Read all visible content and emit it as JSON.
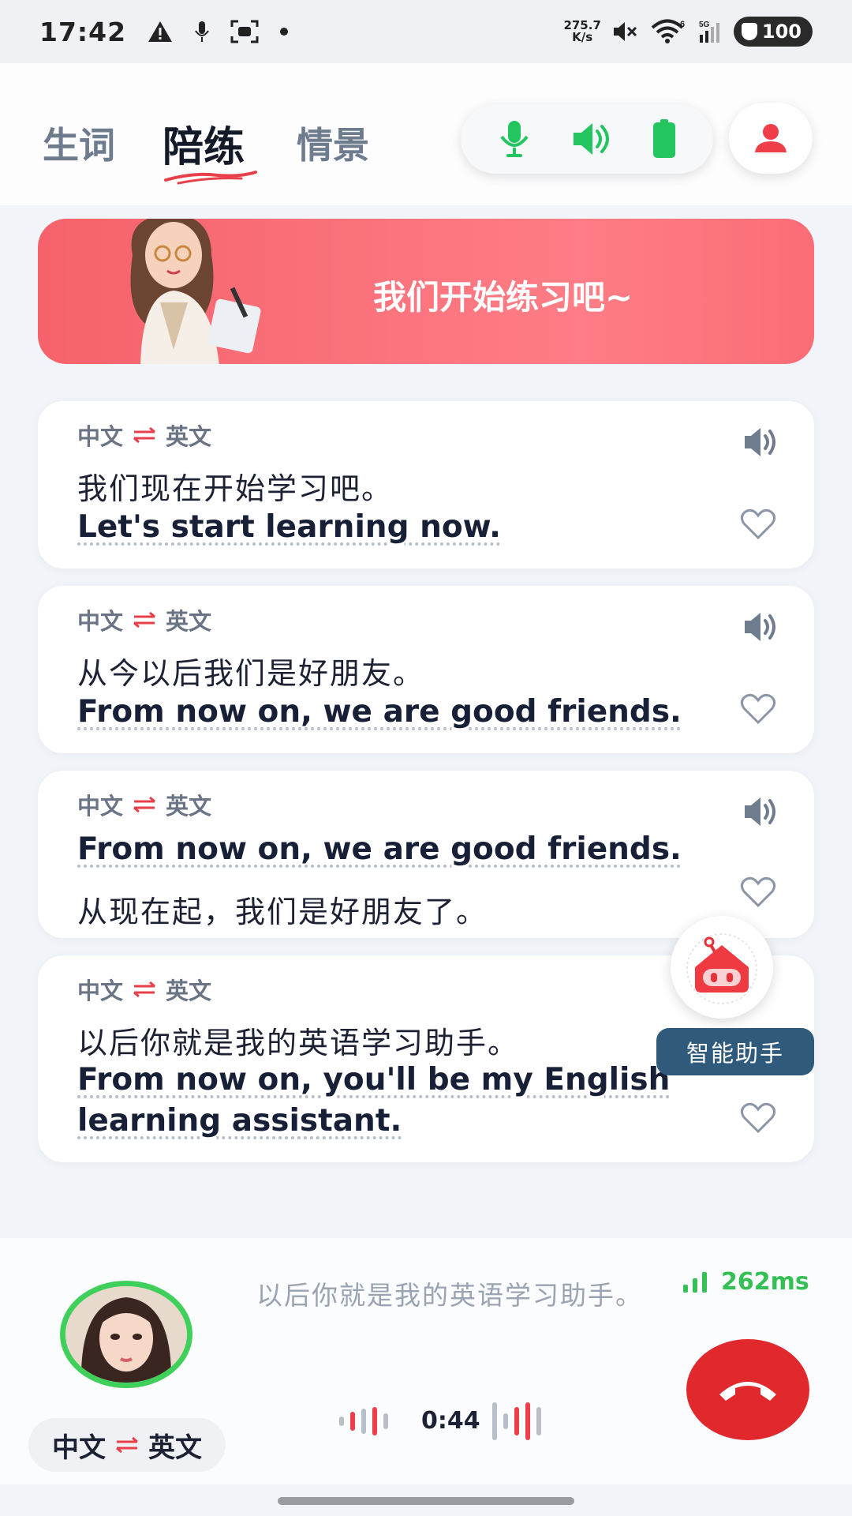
{
  "status_bar": {
    "time": "17:42",
    "net_speed_value": "275.7",
    "net_speed_unit": "K/s",
    "wifi_badge": "6",
    "signal_badge": "5G",
    "battery": "100"
  },
  "tabs": [
    {
      "label": "生词",
      "active": false
    },
    {
      "label": "陪练",
      "active": true
    },
    {
      "label": "情景",
      "active": false
    }
  ],
  "controls": {
    "icons": [
      "mic-icon",
      "speaker-icon",
      "battery-icon"
    ],
    "accent": "#22c55e"
  },
  "banner": {
    "text": "我们开始练习吧~",
    "color": "#f5626b"
  },
  "cards": [
    {
      "lang_from": "中文",
      "lang_to": "英文",
      "line1": "我们现在开始学习吧。",
      "line2": "Let's start learning now."
    },
    {
      "lang_from": "中文",
      "lang_to": "英文",
      "line1": "从今以后我们是好朋友。",
      "line2": "From now on, we are good friends."
    },
    {
      "lang_from": "中文",
      "lang_to": "英文",
      "line1": "From now on, we are good friends.",
      "line2": "从现在起，我们是好朋友了。"
    },
    {
      "lang_from": "中文",
      "lang_to": "英文",
      "line1": "以后你就是我的英语学习助手。",
      "line2": "From now on, you'll be my English learning assistant."
    }
  ],
  "assistant": {
    "label": "智能助手"
  },
  "call_panel": {
    "live_text": "以后你就是我的英语学习助手。",
    "latency": "262ms",
    "timer": "0:44",
    "lang_from": "中文",
    "lang_to": "英文",
    "hangup_color": "#e0282d"
  }
}
